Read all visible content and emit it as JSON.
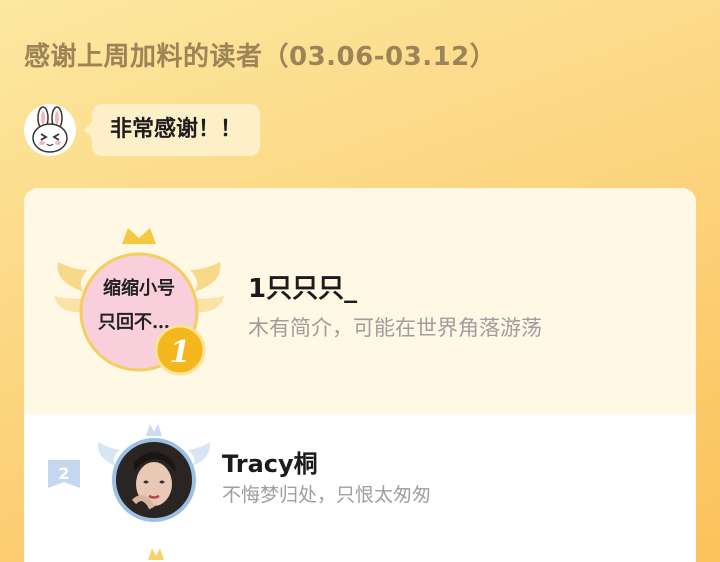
{
  "header": {
    "title": "感谢上周加料的读者（03.06-03.12）"
  },
  "message": {
    "text": "非常感谢！！"
  },
  "ranking": [
    {
      "rank": "1",
      "name": "1只只只_",
      "bio": "木有简介，可能在世界角落游荡",
      "avatar_text_line1": "缩缩小号",
      "avatar_text_line2": "只回不…"
    },
    {
      "rank": "2",
      "name": "Tracy桐",
      "bio": "不悔梦归处，只恨太匆匆"
    }
  ],
  "colors": {
    "accent_gold": "#f2b81c",
    "rank2_blue": "#9cc0e2",
    "card_top_bg": "#fff8e4"
  },
  "icons": {
    "author_avatar": "bunny-avatar-icon",
    "crown": "crown-icon",
    "wings": "wings-icon",
    "rank_medal": "medal-icon"
  }
}
